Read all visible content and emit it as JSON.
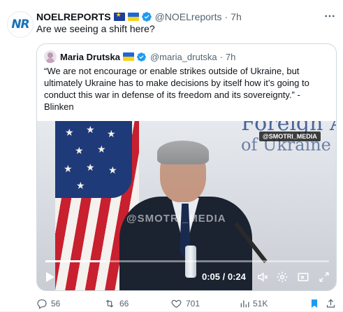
{
  "post": {
    "author_name": "NOELREPORTS",
    "author_handle": "@NOELreports",
    "time": "7h",
    "separator": "·",
    "text": "Are we seeing a shift here?",
    "avatar_text": "NR",
    "more_icon": "more-horizontal-icon"
  },
  "quote": {
    "author_name": "Maria Drutska",
    "author_handle": "@maria_drutska",
    "time": "7h",
    "separator": "·",
    "text": "“We are not encourage or enable strikes outside of Ukraine, but ultimately Ukraine has to make decisions by itself how it’s going to conduct this war in defense of its freedom and its sovereignty.” - Blinken"
  },
  "video": {
    "sign_line1": "Foreign A",
    "sign_line2": "of Ukraine",
    "watermark_top": "@SMOTRI_MEDIA",
    "watermark_mid": "@SMOTRI_MEDIA",
    "timecode": "0:05 / 0:24",
    "progress_fraction": 0.21
  },
  "actions": {
    "replies": "56",
    "reposts": "66",
    "likes": "701",
    "views": "51K"
  },
  "colors": {
    "accent": "#1d9bf0",
    "muted": "#536471",
    "text": "#0f1419",
    "border": "#cfd9de"
  }
}
